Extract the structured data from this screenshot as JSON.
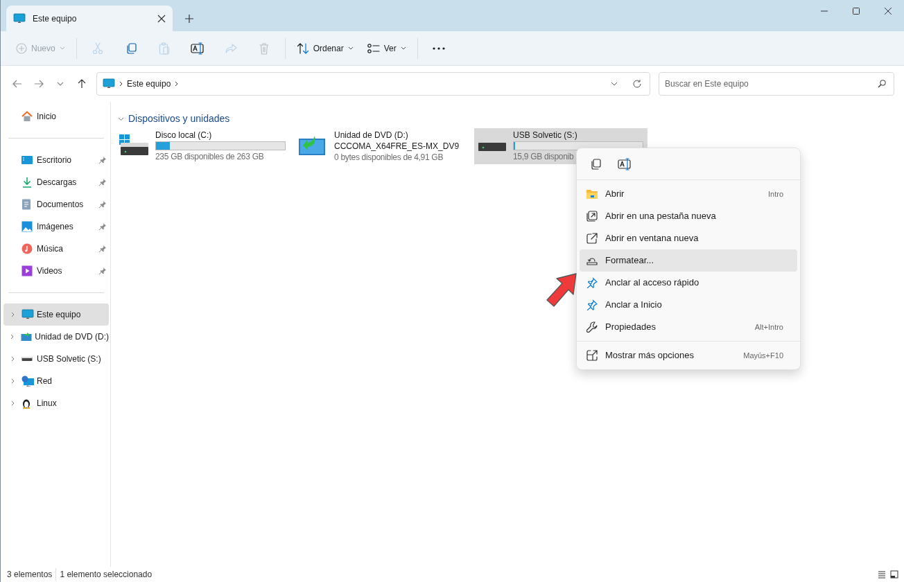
{
  "tab": {
    "title": "Este equipo"
  },
  "toolbar": [
    {
      "kind": "new",
      "label": "Nuevo",
      "disabled": true
    },
    {
      "kind": "cut",
      "disabled": true
    },
    {
      "kind": "copy",
      "disabled": false
    },
    {
      "kind": "paste",
      "disabled": true
    },
    {
      "kind": "rename",
      "disabled": false
    },
    {
      "kind": "share",
      "disabled": true
    },
    {
      "kind": "delete",
      "disabled": true
    },
    {
      "kind": "sort",
      "label": "Ordenar",
      "disabled": false
    },
    {
      "kind": "view",
      "label": "Ver",
      "disabled": false
    },
    {
      "kind": "more",
      "disabled": false
    }
  ],
  "address": {
    "path": [
      "Este equipo"
    ]
  },
  "search": {
    "placeholder": "Buscar en Este equipo"
  },
  "sidebar": {
    "groups": [
      [
        {
          "kind": "home",
          "label": "Inicio",
          "selected": false
        }
      ],
      [
        {
          "kind": "desktop",
          "label": "Escritorio",
          "pinned": true,
          "selected": false
        },
        {
          "kind": "downloads",
          "label": "Descargas",
          "pinned": true,
          "selected": false
        },
        {
          "kind": "documents",
          "label": "Documentos",
          "pinned": true,
          "selected": false
        },
        {
          "kind": "pictures",
          "label": "Imágenes",
          "pinned": true,
          "selected": false
        },
        {
          "kind": "music",
          "label": "Música",
          "pinned": true,
          "selected": false
        },
        {
          "kind": "videos",
          "label": "Videos",
          "pinned": true,
          "selected": false
        }
      ],
      [
        {
          "kind": "pc",
          "label": "Este equipo",
          "expandable": true,
          "selected": true
        },
        {
          "kind": "dvd",
          "label": "Unidad de DVD (D:)",
          "expandable": true,
          "selected": false
        },
        {
          "kind": "usb",
          "label": "USB Solvetic (S:)",
          "expandable": true,
          "selected": false
        },
        {
          "kind": "network",
          "label": "Red",
          "expandable": true,
          "selected": false
        },
        {
          "kind": "linux",
          "label": "Linux",
          "expandable": true,
          "selected": false
        }
      ]
    ]
  },
  "section": {
    "title": "Dispositivos y unidades",
    "expanded": true
  },
  "drives": [
    {
      "kind": "system",
      "name": "Disco local (C:)",
      "level": 0.11,
      "free": "235 GB disponibles de 263 GB",
      "selected": false
    },
    {
      "kind": "dvd",
      "name": "Unidad de DVD (D:)",
      "label": "CCCOMA_X64FRE_ES-MX_DV9",
      "free": "0 bytes disponibles de 4,91 GB",
      "selected": false
    },
    {
      "kind": "usb",
      "name": "USB Solvetic (S:)",
      "level": 0.01,
      "free": "15,9 GB disponib",
      "selected": true
    }
  ],
  "context_menu": {
    "quick_actions": [
      {
        "kind": "copy"
      },
      {
        "kind": "rename"
      }
    ],
    "groups": [
      [
        {
          "kind": "open",
          "label": "Abrir",
          "shortcut": "Intro",
          "selected": false
        },
        {
          "kind": "newtab",
          "label": "Abrir en una pestaña nueva",
          "selected": false
        },
        {
          "kind": "newwindow",
          "label": "Abrir en ventana nueva",
          "selected": false
        },
        {
          "kind": "format",
          "label": "Formatear...",
          "selected": true
        },
        {
          "kind": "pin",
          "label": "Anclar al acceso rápido",
          "selected": false
        },
        {
          "kind": "pin",
          "label": "Anclar a Inicio",
          "selected": false
        },
        {
          "kind": "properties",
          "label": "Propiedades",
          "shortcut": "Alt+Intro",
          "selected": false
        }
      ],
      [
        {
          "kind": "more",
          "label": "Mostrar más opciones",
          "shortcut": "Mayús+F10",
          "selected": false
        }
      ]
    ]
  },
  "status_bar": [
    "3 elementos",
    "1 elemento seleccionado"
  ]
}
